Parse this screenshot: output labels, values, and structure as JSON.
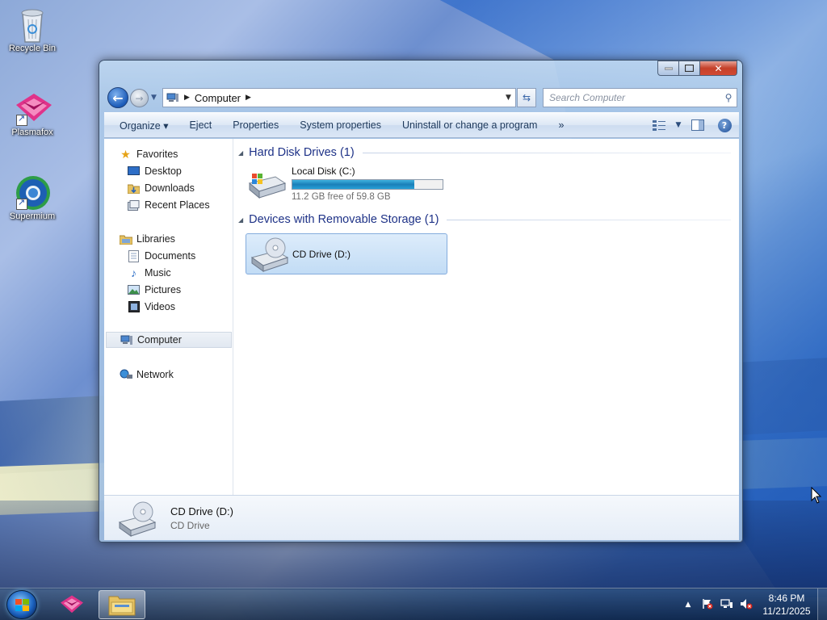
{
  "desktop": {
    "icons": [
      {
        "label": "Recycle Bin",
        "icon": "recycle-bin-icon"
      },
      {
        "label": "Plasmafox",
        "icon": "plasmafox-icon"
      },
      {
        "label": "Supermium",
        "icon": "supermium-icon"
      }
    ]
  },
  "window": {
    "address": {
      "crumb": "Computer"
    },
    "search": {
      "placeholder": "Search Computer"
    },
    "toolbar": {
      "organize": "Organize ▾",
      "eject": "Eject",
      "properties": "Properties",
      "system_properties": "System properties",
      "uninstall": "Uninstall or change a program",
      "more": "»"
    },
    "nav": {
      "favorites": "Favorites",
      "desktop": "Desktop",
      "downloads": "Downloads",
      "recent": "Recent Places",
      "libraries": "Libraries",
      "documents": "Documents",
      "music": "Music",
      "pictures": "Pictures",
      "videos": "Videos",
      "computer": "Computer",
      "network": "Network"
    },
    "groups": {
      "hdd": "Hard Disk Drives (1)",
      "removable": "Devices with Removable Storage (1)"
    },
    "drives": {
      "local": {
        "name": "Local Disk (C:)",
        "free": "11.2 GB free of 59.8 GB",
        "used_fraction": 0.81
      },
      "cd": {
        "name": "CD Drive (D:)"
      }
    },
    "details": {
      "name": "CD Drive (D:)",
      "type": "CD Drive"
    }
  },
  "taskbar": {
    "time": "8:46 PM",
    "date": "11/21/2025"
  },
  "colors": {
    "accent": "#1e3287",
    "selection": "#cce4f7",
    "bar_fill": "#27a0d8"
  }
}
